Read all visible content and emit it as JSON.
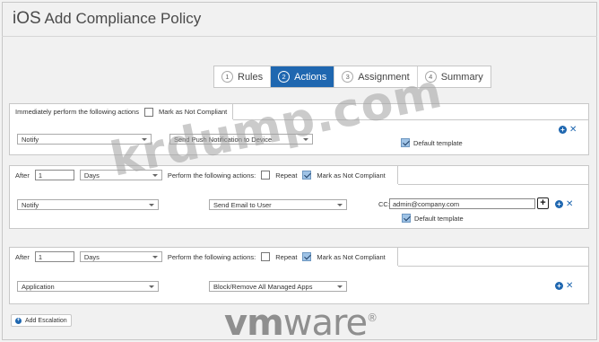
{
  "header": {
    "os": "iOS",
    "title": "Add Compliance Policy"
  },
  "wizard": {
    "steps": [
      {
        "num": "1",
        "label": "Rules"
      },
      {
        "num": "2",
        "label": "Actions"
      },
      {
        "num": "3",
        "label": "Assignment"
      },
      {
        "num": "4",
        "label": "Summary"
      }
    ],
    "active": "Actions"
  },
  "section1": {
    "immediate_label": "Immediately perform the following actions",
    "mark_label": "Mark as Not Compliant",
    "action_type": "Notify",
    "action": "Send Push Notification to Device",
    "default_template_label": "Default template"
  },
  "section2": {
    "after_label": "After",
    "after_value": "1",
    "unit": "Days",
    "perform_label": "Perform the following actions:",
    "repeat_label": "Repeat",
    "mark_label": "Mark as Not Compliant",
    "action_type": "Notify",
    "action": "Send Email to User",
    "cc_label": "CC:",
    "cc_value": "admin@company.com",
    "default_template_label": "Default template"
  },
  "section3": {
    "after_label": "After",
    "after_value": "1",
    "unit": "Days",
    "perform_label": "Perform the following actions:",
    "repeat_label": "Repeat",
    "mark_label": "Mark as Not Compliant",
    "action_type": "Application",
    "action": "Block/Remove All Managed Apps"
  },
  "add_escalation": "Add Escalation",
  "logo": "vmware",
  "watermark": "krdump.com",
  "colors": {
    "accent": "#1f67b0",
    "check_on": "#9fc3e6"
  }
}
